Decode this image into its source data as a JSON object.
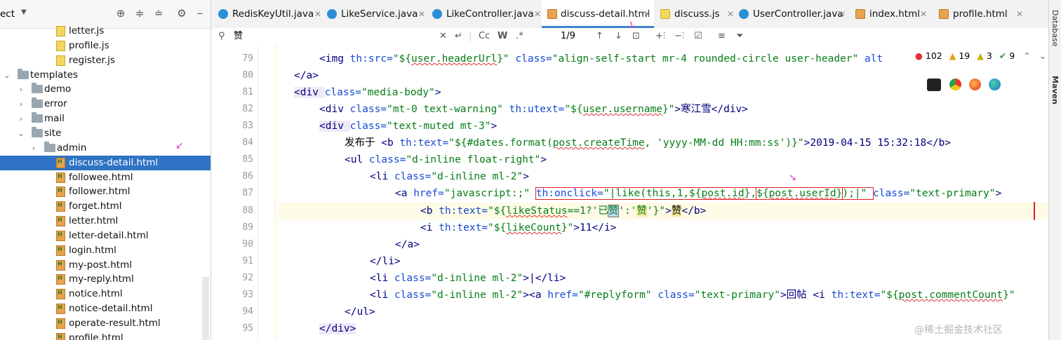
{
  "project_panel": {
    "header_label": "ect",
    "items": [
      {
        "label": "letter.js",
        "kind": "js"
      },
      {
        "label": "profile.js",
        "kind": "js"
      },
      {
        "label": "register.js",
        "kind": "js"
      },
      {
        "label": "templates",
        "kind": "folder"
      },
      {
        "label": "demo",
        "kind": "folder"
      },
      {
        "label": "error",
        "kind": "folder"
      },
      {
        "label": "mail",
        "kind": "folder"
      },
      {
        "label": "site",
        "kind": "folder"
      },
      {
        "label": "admin",
        "kind": "folder"
      },
      {
        "label": "discuss-detail.html",
        "kind": "html"
      },
      {
        "label": "followee.html",
        "kind": "html"
      },
      {
        "label": "follower.html",
        "kind": "html"
      },
      {
        "label": "forget.html",
        "kind": "html"
      },
      {
        "label": "letter.html",
        "kind": "html"
      },
      {
        "label": "letter-detail.html",
        "kind": "html"
      },
      {
        "label": "login.html",
        "kind": "html"
      },
      {
        "label": "my-post.html",
        "kind": "html"
      },
      {
        "label": "my-reply.html",
        "kind": "html"
      },
      {
        "label": "notice.html",
        "kind": "html"
      },
      {
        "label": "notice-detail.html",
        "kind": "html"
      },
      {
        "label": "operate-result.html",
        "kind": "html"
      },
      {
        "label": "profile.html",
        "kind": "html"
      }
    ]
  },
  "tabs": [
    {
      "label": "RedisKeyUtil.java"
    },
    {
      "label": "LikeService.java"
    },
    {
      "label": "LikeController.java"
    },
    {
      "label": "discuss-detail.html"
    },
    {
      "label": "discuss.js"
    },
    {
      "label": "UserController.java"
    },
    {
      "label": "index.html"
    },
    {
      "label": "profile.html"
    }
  ],
  "search": {
    "query": "赞",
    "cc": "Cc",
    "w": "W",
    "regex": ".*",
    "match_count": "1/9"
  },
  "inspections": {
    "errors": "102",
    "warnings": "19",
    "weak": "3",
    "typos": "9"
  },
  "line_numbers": [
    "79",
    "80",
    "81",
    "82",
    "83",
    "84",
    "85",
    "86",
    "87",
    "88",
    "89",
    "90",
    "91",
    "92",
    "93",
    "94",
    "95"
  ],
  "right_tools": {
    "database": "Database",
    "maven": "Maven"
  },
  "watermark": "@稀土掘金技术社区",
  "code": {
    "l79a": "<img ",
    "l79b": "th:src=",
    "l79c": "\"${",
    "l79d": "user.headerUrl",
    "l79e": "}\" ",
    "l79f": "class=",
    "l79g": "\"align-self-start mr-4 rounded-circle user-header\" ",
    "l79h": "alt",
    "l80": "</a>",
    "l81a": "<div ",
    "l81b": "class=",
    "l81c": "\"media-body\"",
    "l81d": ">",
    "l82a": "<div ",
    "l82b": "class=",
    "l82c": "\"mt-0 text-warning\" ",
    "l82d": "th:utext=",
    "l82e": "\"${",
    "l82f": "user.username",
    "l82g": "}\"",
    "l82h": ">寒江雪</div>",
    "l83a": "<div ",
    "l83b": "class=",
    "l83c": "\"text-muted mt-3\"",
    "l83d": ">",
    "l84a": "发布于 ",
    "l84b": "<b ",
    "l84c": "th:text=",
    "l84d": "\"${#dates.format(",
    "l84e": "post.createTime",
    "l84f": ", 'yyyy-MM-dd HH:mm:ss')}\"",
    "l84g": ">2019-04-15 15:32:18</b>",
    "l85a": "<ul ",
    "l85b": "class=",
    "l85c": "\"d-inline float-right\"",
    "l85d": ">",
    "l86a": "<li ",
    "l86b": "class=",
    "l86c": "\"d-inline ml-2\"",
    "l86d": ">",
    "l87a": "<a ",
    "l87b": "href=",
    "l87c": "\"javascript:;\" ",
    "l87d": "th:onclick=",
    "l87e": "\"|like(this,1,${",
    "l87f": "post.id",
    "l87g": "},",
    "l87h": "${",
    "l87i": "post.userId",
    "l87j": "}",
    "l87k": ");|\" ",
    "l87l": "class=",
    "l87m": "\"text-primary\"",
    "l87n": ">",
    "l88a": "<b ",
    "l88b": "th:text=",
    "l88c": "\"${",
    "l88d": "likeStatus",
    "l88e": "==1?'已",
    "l88f": "赞",
    "l88g": "':'",
    "l88h": "赞",
    "l88i": "'}\"",
    "l88j": ">",
    "l88k": "赞",
    "l88l": "</b>",
    "l89a": "<i ",
    "l89b": "th:text=",
    "l89c": "\"${",
    "l89d": "likeCount",
    "l89e": "}\"",
    "l89f": ">11</i>",
    "l90": "</a>",
    "l91": "</li>",
    "l92a": "<li ",
    "l92b": "class=",
    "l92c": "\"d-inline ml-2\"",
    "l92d": ">|</li>",
    "l93a": "<li ",
    "l93b": "class=",
    "l93c": "\"d-inline ml-2\"",
    "l93d": "><a ",
    "l93e": "href=",
    "l93f": "\"#replyform\" ",
    "l93g": "class=",
    "l93h": "\"text-primary\"",
    "l93i": ">回帖 <i ",
    "l93j": "th:text=",
    "l93k": "\"${",
    "l93l": "post.commentCount",
    "l93m": "}\"",
    "l94": "</ul>",
    "l95": "</div>"
  }
}
